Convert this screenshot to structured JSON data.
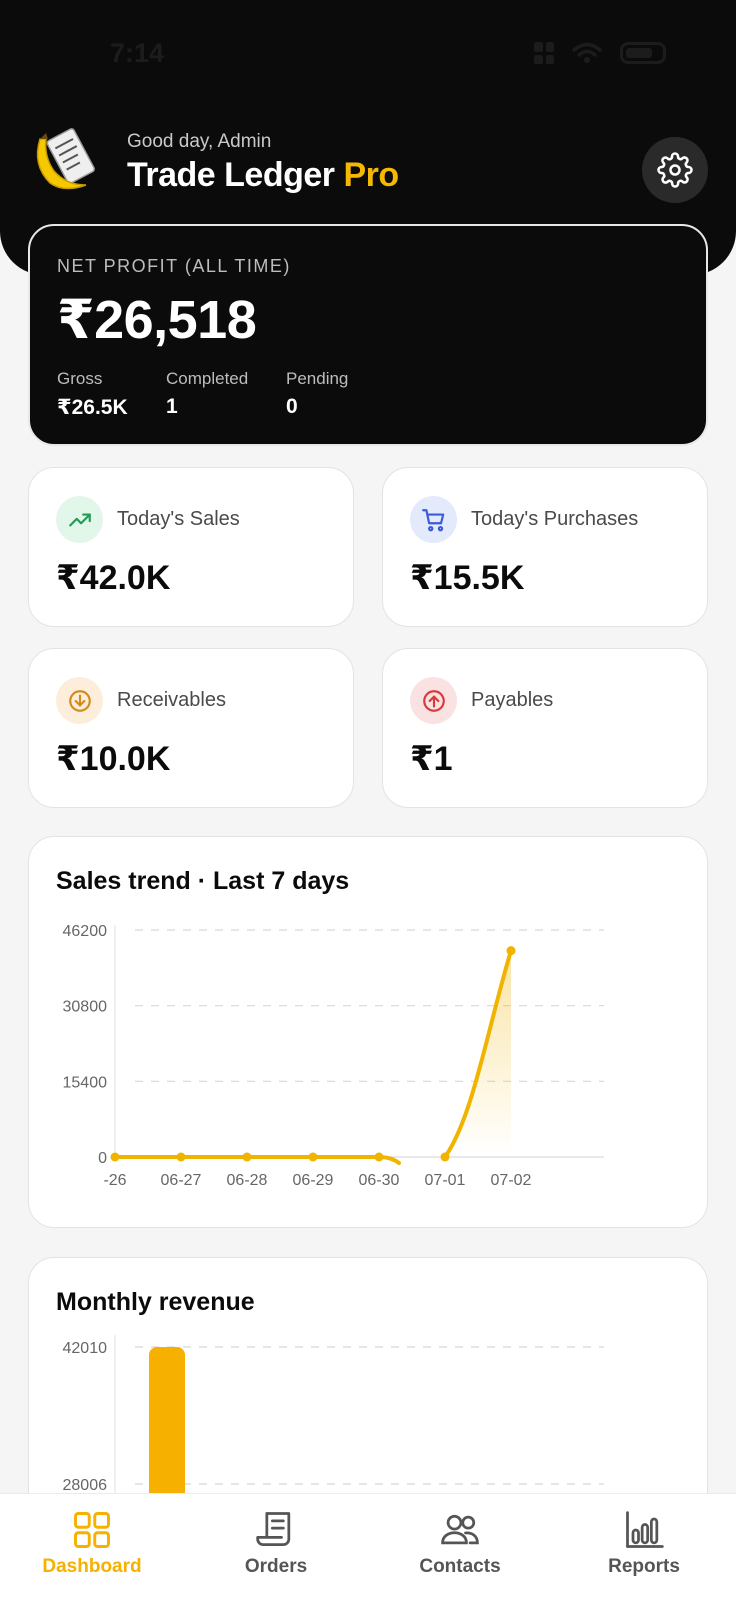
{
  "status_bar": {
    "time": "7:14"
  },
  "header": {
    "greeting": "Good day, Admin",
    "title_main": "Trade Ledger",
    "title_accent": "Pro",
    "settings_icon": "gear-icon",
    "brand_color": "#f5b800"
  },
  "profit": {
    "label": "NET PROFIT (ALL TIME)",
    "value": "₹26,518",
    "stats": [
      {
        "label": "Gross",
        "value": "₹26.5K"
      },
      {
        "label": "Completed",
        "value": "1"
      },
      {
        "label": "Pending",
        "value": "0"
      }
    ]
  },
  "cards": {
    "sales": {
      "title": "Today's Sales",
      "value": "₹42.0K",
      "icon": "trending-up-icon"
    },
    "purchases": {
      "title": "Today's Purchases",
      "value": "₹15.5K",
      "icon": "cart-icon"
    },
    "receivables": {
      "title": "Receivables",
      "value": "₹10.0K",
      "icon": "arrow-down-circle-icon"
    },
    "payables": {
      "title": "Payables",
      "value": "₹1",
      "icon": "arrow-up-circle-icon"
    }
  },
  "chart_data": [
    {
      "type": "line",
      "title": "Sales trend · Last 7 days",
      "x": [
        "-26",
        "06-27",
        "06-28",
        "06-29",
        "06-30",
        "07-01",
        "07-02"
      ],
      "values": [
        0,
        0,
        0,
        0,
        0,
        0,
        42000
      ],
      "yticks": [
        "46200",
        "30800",
        "15400",
        "0"
      ],
      "ylim": [
        0,
        46200
      ],
      "grid": true,
      "color": "#f0b400"
    },
    {
      "type": "bar",
      "title": "Monthly revenue",
      "values": [
        42010
      ],
      "yticks": [
        "42010",
        "28006"
      ],
      "grid": true,
      "color": "#f5b000"
    }
  ],
  "tabs": [
    {
      "label": "Dashboard",
      "icon": "dashboard-icon",
      "active": true
    },
    {
      "label": "Orders",
      "icon": "orders-icon",
      "active": false
    },
    {
      "label": "Contacts",
      "icon": "contacts-icon",
      "active": false
    },
    {
      "label": "Reports",
      "icon": "reports-icon",
      "active": false
    }
  ]
}
